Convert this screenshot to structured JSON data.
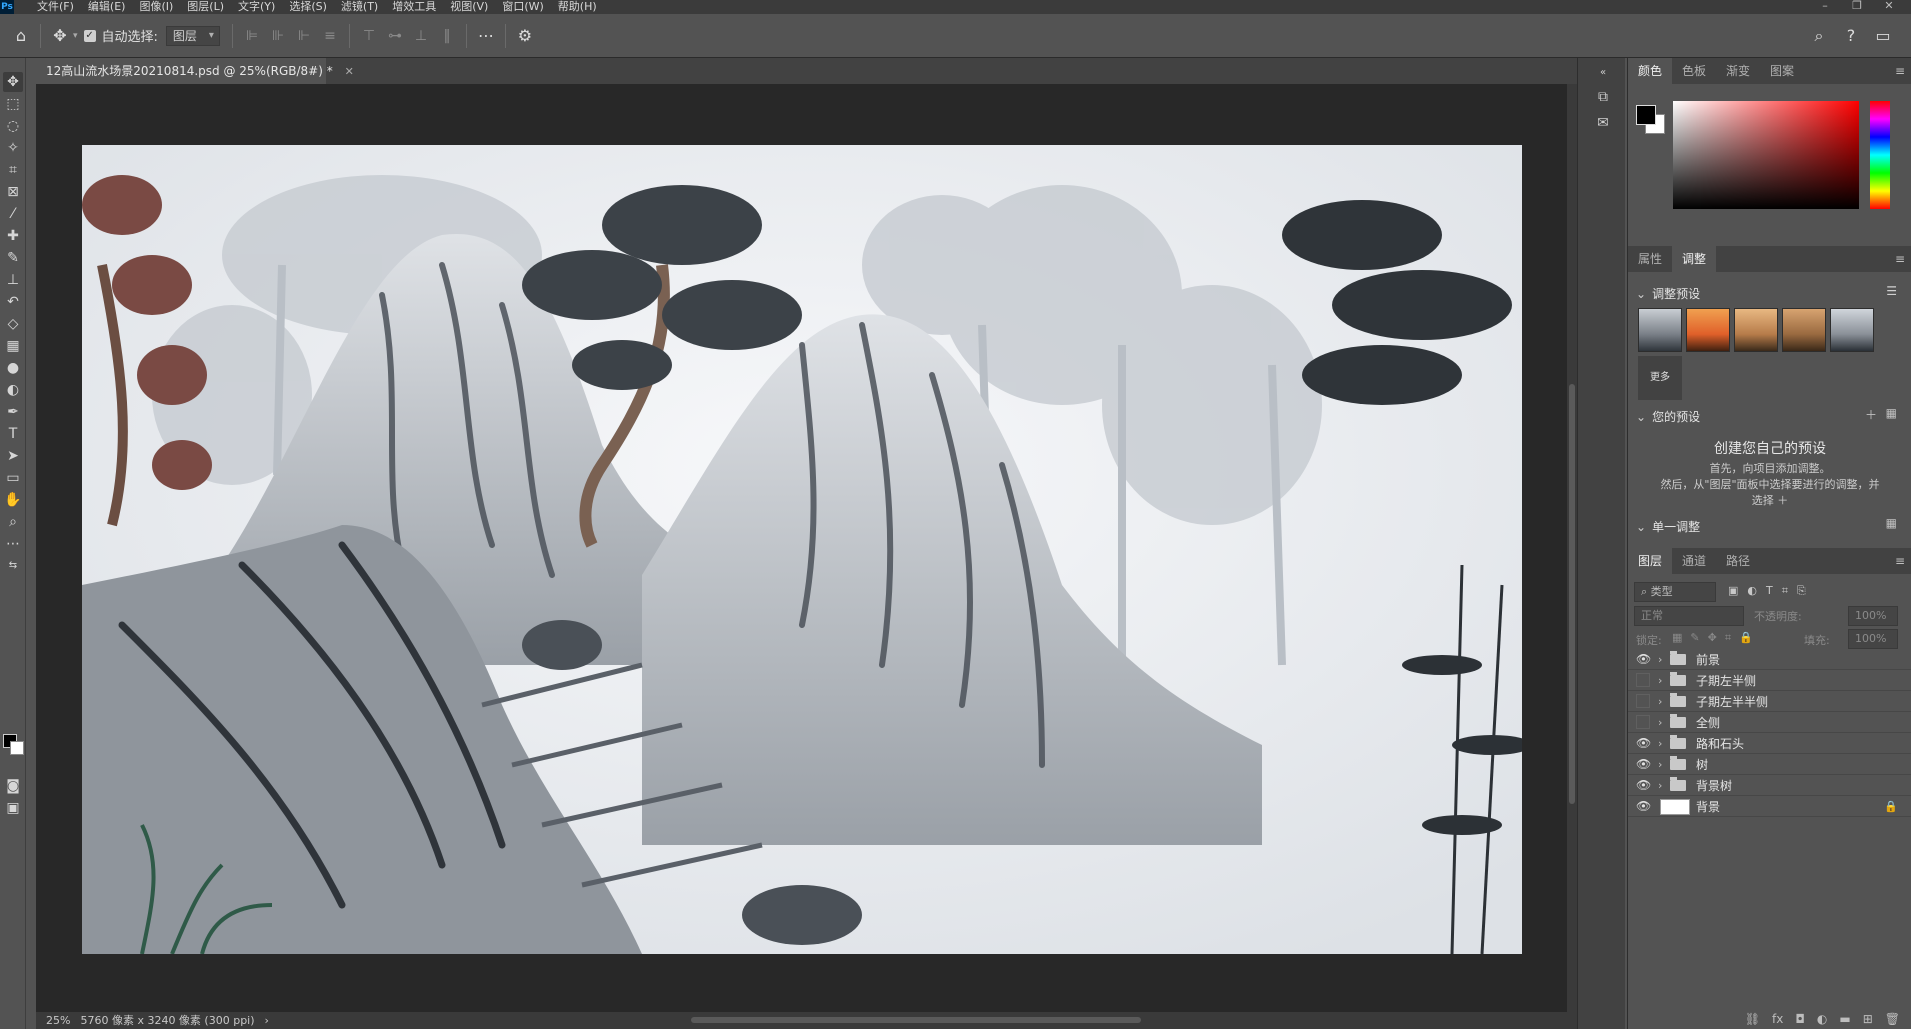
{
  "menubar": {
    "items": [
      "文件(F)",
      "编辑(E)",
      "图像(I)",
      "图层(L)",
      "文字(Y)",
      "选择(S)",
      "滤镜(T)",
      "增效工具",
      "视图(V)",
      "窗口(W)",
      "帮助(H)"
    ],
    "ps_logo": "Ps"
  },
  "options": {
    "auto_select_label": "自动选择:",
    "auto_select_checked": true,
    "select_value": "图层"
  },
  "document": {
    "tab_title": "12高山流水场景20210814.psd @ 25%(RGB/8#) *",
    "zoom": "25%",
    "doc_info": "5760 像素 x 3240 像素 (300 ppi)"
  },
  "color_panel": {
    "tabs": [
      "颜色",
      "色板",
      "渐变",
      "图案"
    ],
    "active_tab": "颜色",
    "foreground": "#000000",
    "background": "#ffffff"
  },
  "adjust_panel": {
    "tabs": [
      "属性",
      "调整"
    ],
    "active_tab": "调整",
    "presets_title": "调整预设",
    "more_label": "更多",
    "your_presets_title": "您的预设",
    "create_title": "创建您自己的预设",
    "create_line1": "首先，向项目添加调整。",
    "create_line2": "然后，从\"图层\"面板中选择要进行的调整，并",
    "create_line3": "选择 ＋",
    "single_adjust_title": "单一调整"
  },
  "layers_panel": {
    "tabs": [
      "图层",
      "通道",
      "路径"
    ],
    "active_tab": "图层",
    "filter_label": "类型",
    "blend_mode": "正常",
    "opacity_label": "不透明度:",
    "opacity_value": "100%",
    "lock_label": "锁定:",
    "fill_label": "填充:",
    "fill_value": "100%",
    "layers": [
      {
        "name": "前景",
        "visible": true,
        "type": "group"
      },
      {
        "name": "子期左半侧",
        "visible": false,
        "type": "group"
      },
      {
        "name": "子期左半半侧",
        "visible": false,
        "type": "group"
      },
      {
        "name": "全侧",
        "visible": false,
        "type": "group"
      },
      {
        "name": "路和石头",
        "visible": true,
        "type": "group"
      },
      {
        "name": "树",
        "visible": true,
        "type": "group"
      },
      {
        "name": "背景树",
        "visible": true,
        "type": "group"
      },
      {
        "name": "背景",
        "visible": true,
        "type": "background",
        "locked": true
      }
    ]
  }
}
